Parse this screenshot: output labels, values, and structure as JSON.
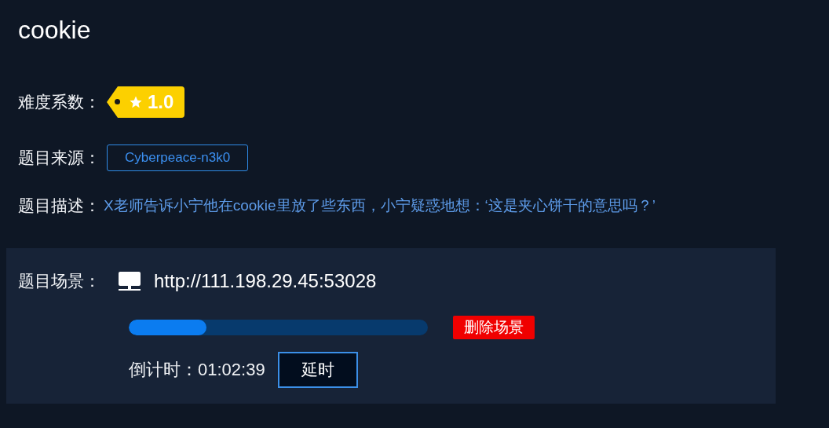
{
  "title": "cookie",
  "difficulty": {
    "label": "难度系数：",
    "value": "1.0"
  },
  "source": {
    "label": "题目来源：",
    "value": "Cyberpeace-n3k0"
  },
  "description": {
    "label": "题目描述：",
    "value": "X老师告诉小宁他在cookie里放了些东西，小宁疑惑地想：‘这是夹心饼干的意思吗？’"
  },
  "scene": {
    "label": "题目场景：",
    "url": "http://111.198.29.45:53028",
    "level": 0.26,
    "delete_button": "删除场景",
    "countdown": {
      "label": "倒计时：",
      "value": "01:02:39"
    },
    "extend_button": "延时"
  }
}
